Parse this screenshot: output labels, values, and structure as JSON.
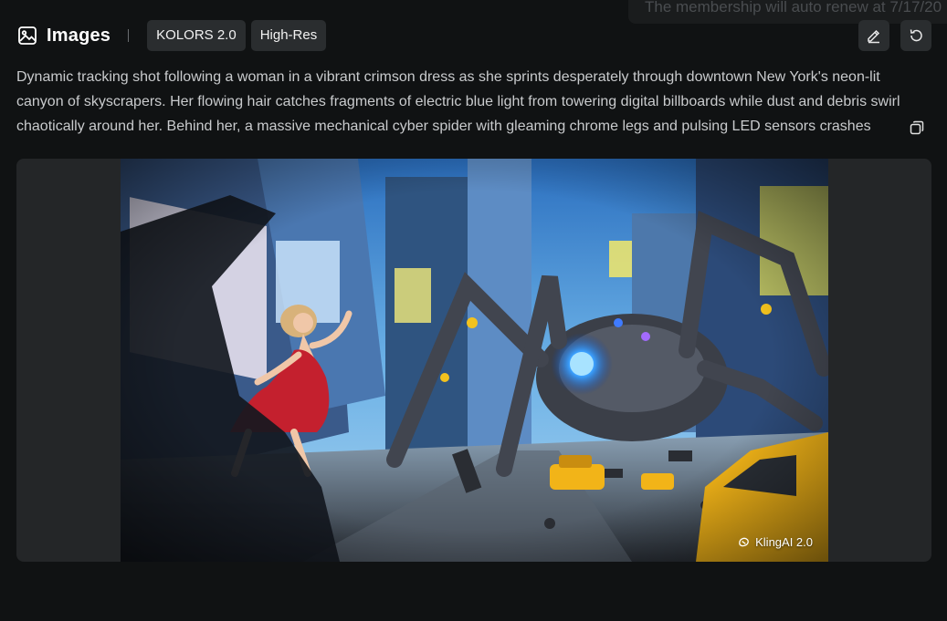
{
  "toast": {
    "text": "The membership will auto renew at 7/17/20"
  },
  "header": {
    "title": "Images",
    "title_icon": "image-icon",
    "tags": [
      "KOLORS 2.0",
      "High-Res"
    ],
    "actions": [
      {
        "name": "edit",
        "icon": "pencil-icon"
      },
      {
        "name": "regenerate",
        "icon": "refresh-icon"
      }
    ]
  },
  "prompt": {
    "text": "Dynamic tracking shot following a woman in a vibrant crimson dress as she sprints desperately through downtown New York's neon-lit canyon of skyscrapers. Her flowing hair catches fragments of electric blue light from towering digital billboards while dust and debris swirl chaotically around her. Behind her, a massive mechanical cyber spider with gleaming chrome legs and pulsing LED sensors crashes",
    "copy_icon": "copy-icon"
  },
  "image": {
    "watermark": "KlingAI 2.0",
    "watermark_icon": "klingai-logo-icon"
  },
  "colors": {
    "background": "#101213",
    "panel": "#242628",
    "tag_bg": "#2a2d2f",
    "text": "#c9cbcd",
    "dress": "#c4202e",
    "sensor": "#2f8cff",
    "taxi": "#f2b418"
  }
}
